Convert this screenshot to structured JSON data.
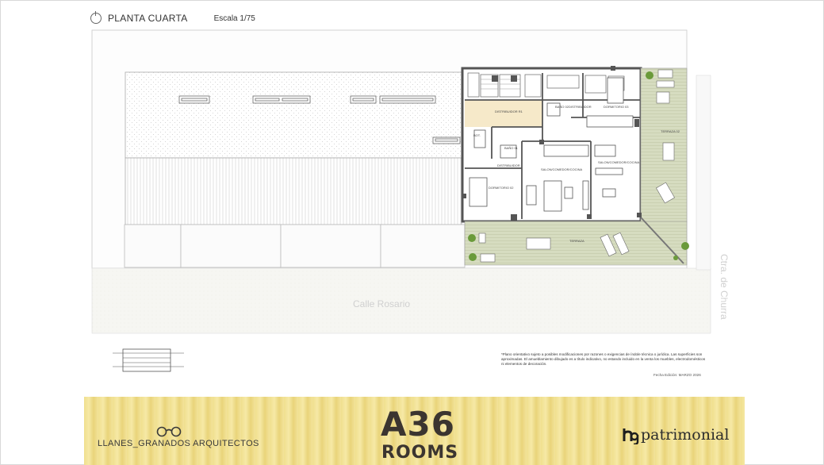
{
  "header": {
    "title": "PLANTA CUARTA",
    "scale": "Escala 1/75"
  },
  "plan": {
    "street_bottom": "Calle Rosario",
    "street_right": "Ctra. de Churra",
    "rooms": {
      "distribuidor_r1": "DISTRIBUIDOR R1",
      "bano_02": "BAÑO 02",
      "distribuidor_top": "DISTRIBUIDOR",
      "dormitorio_03": "DORMITORIO 03",
      "terraza_02": "TERRAZA 02",
      "bano_01_small": "BOT.",
      "bano_01": "BAÑO 01",
      "distribuidor_mid": "DISTRIBUIDOR",
      "salon_cocina_left": "SALON/COMEDOR/COCINA",
      "salon_cocina_right": "SALON/COMEDOR/COCINA",
      "dormitorio_02": "DORMITORIO 02",
      "terraza": "TERRAZA"
    }
  },
  "footnote": {
    "text": "*Plano orientativo sujeto a posibles modificaciones por razones o exigencias de índole técnica o jurídica. Las superficies son aproximadas. El amueblamiento dibujado es a título indicativo, no estando incluido en la venta los muebles, electrodomésticos ni elementos de decoración.",
    "date": "Fecha Edición: MARZO 2026"
  },
  "banner": {
    "architect": "LLANES_GRANADOS ARQUITECTOS",
    "logo_main": "A36",
    "logo_sub": "ROOMS",
    "developer": "patrimonial",
    "icons": [
      "glasses-icon",
      "hg-logo-icon",
      "compass-icon"
    ],
    "color_bg": "#f3e39a",
    "color_text": "#3b3530"
  }
}
